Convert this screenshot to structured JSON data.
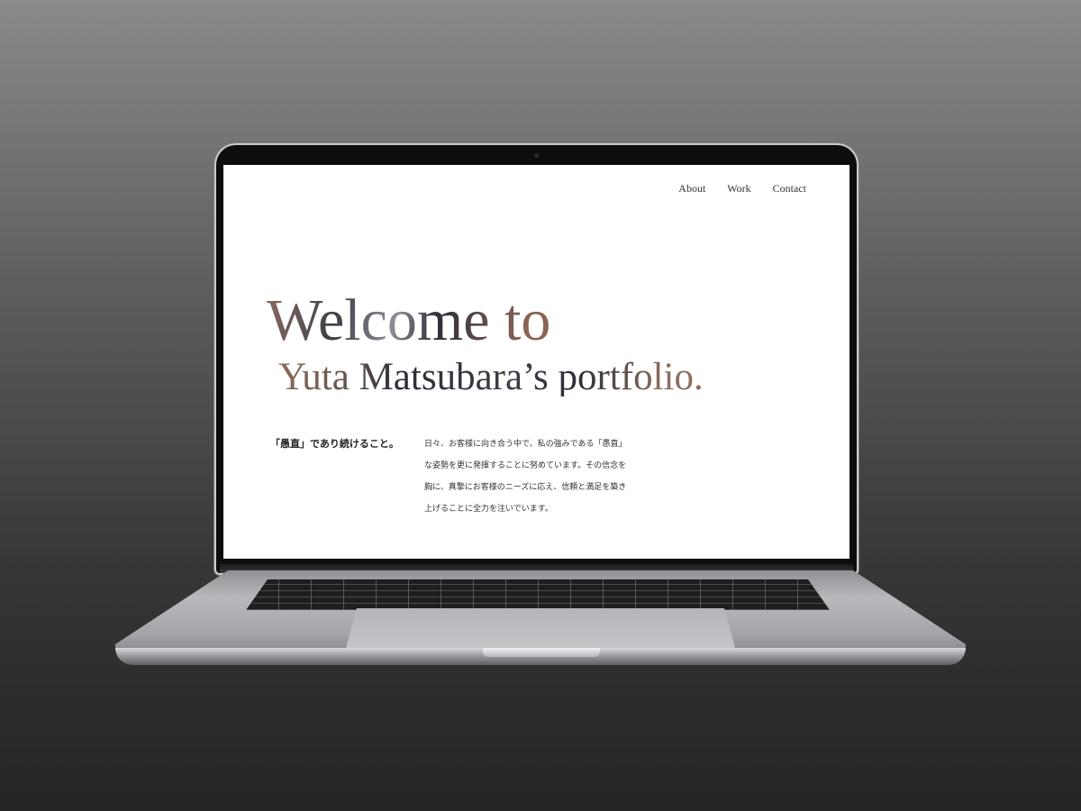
{
  "nav": {
    "items": [
      {
        "label": "About"
      },
      {
        "label": "Work"
      },
      {
        "label": "Contact"
      }
    ]
  },
  "hero": {
    "line1": "Welcome to",
    "line2": "Yuta Matsubara’s portfolio."
  },
  "intro": {
    "tagline": "「愚直」であり続けること。",
    "body_lines": [
      "日々、お客様に向き合う中で、私の強みである「愚直」",
      "な姿勢を更に発揮することに努めています。その信念を",
      "胸に、真摯にお客様のニーズに応え、信頼と満足を築き",
      "上げることに全力を注いでいます。"
    ]
  },
  "colors": {
    "accent_brown": "#8b6a60",
    "dark_slate": "#2d3038",
    "background_top": "#8a8a8a",
    "background_bottom": "#242424"
  }
}
